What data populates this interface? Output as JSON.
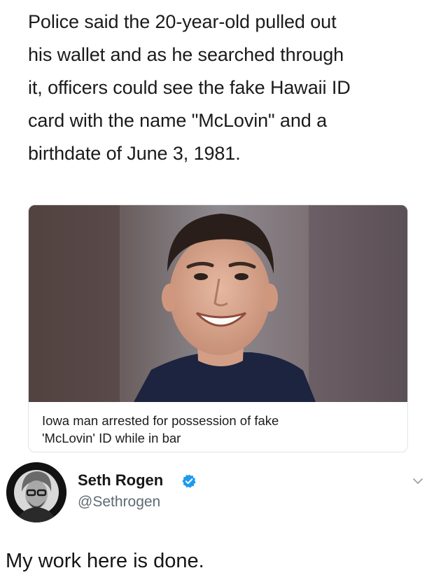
{
  "post": {
    "quote_lines": [
      "Police said the 20-year-old pulled out",
      "his wallet and as he searched through",
      "it, officers could see the fake Hawaii ID",
      "card with the name \"McLovin\" and a",
      "birthdate of June 3, 1981."
    ]
  },
  "article": {
    "caption_lines": [
      "Iowa man arrested for possession of fake",
      "'McLovin' ID while in bar"
    ],
    "image_icon": "mugshot-photo"
  },
  "tweet": {
    "author_name": "Seth Rogen",
    "handle": "@Sethrogen",
    "verified_icon": "verified-badge-icon",
    "menu_icon": "chevron-down-icon",
    "text": "My work here is done.",
    "verified_color": "#1d9bf0"
  }
}
